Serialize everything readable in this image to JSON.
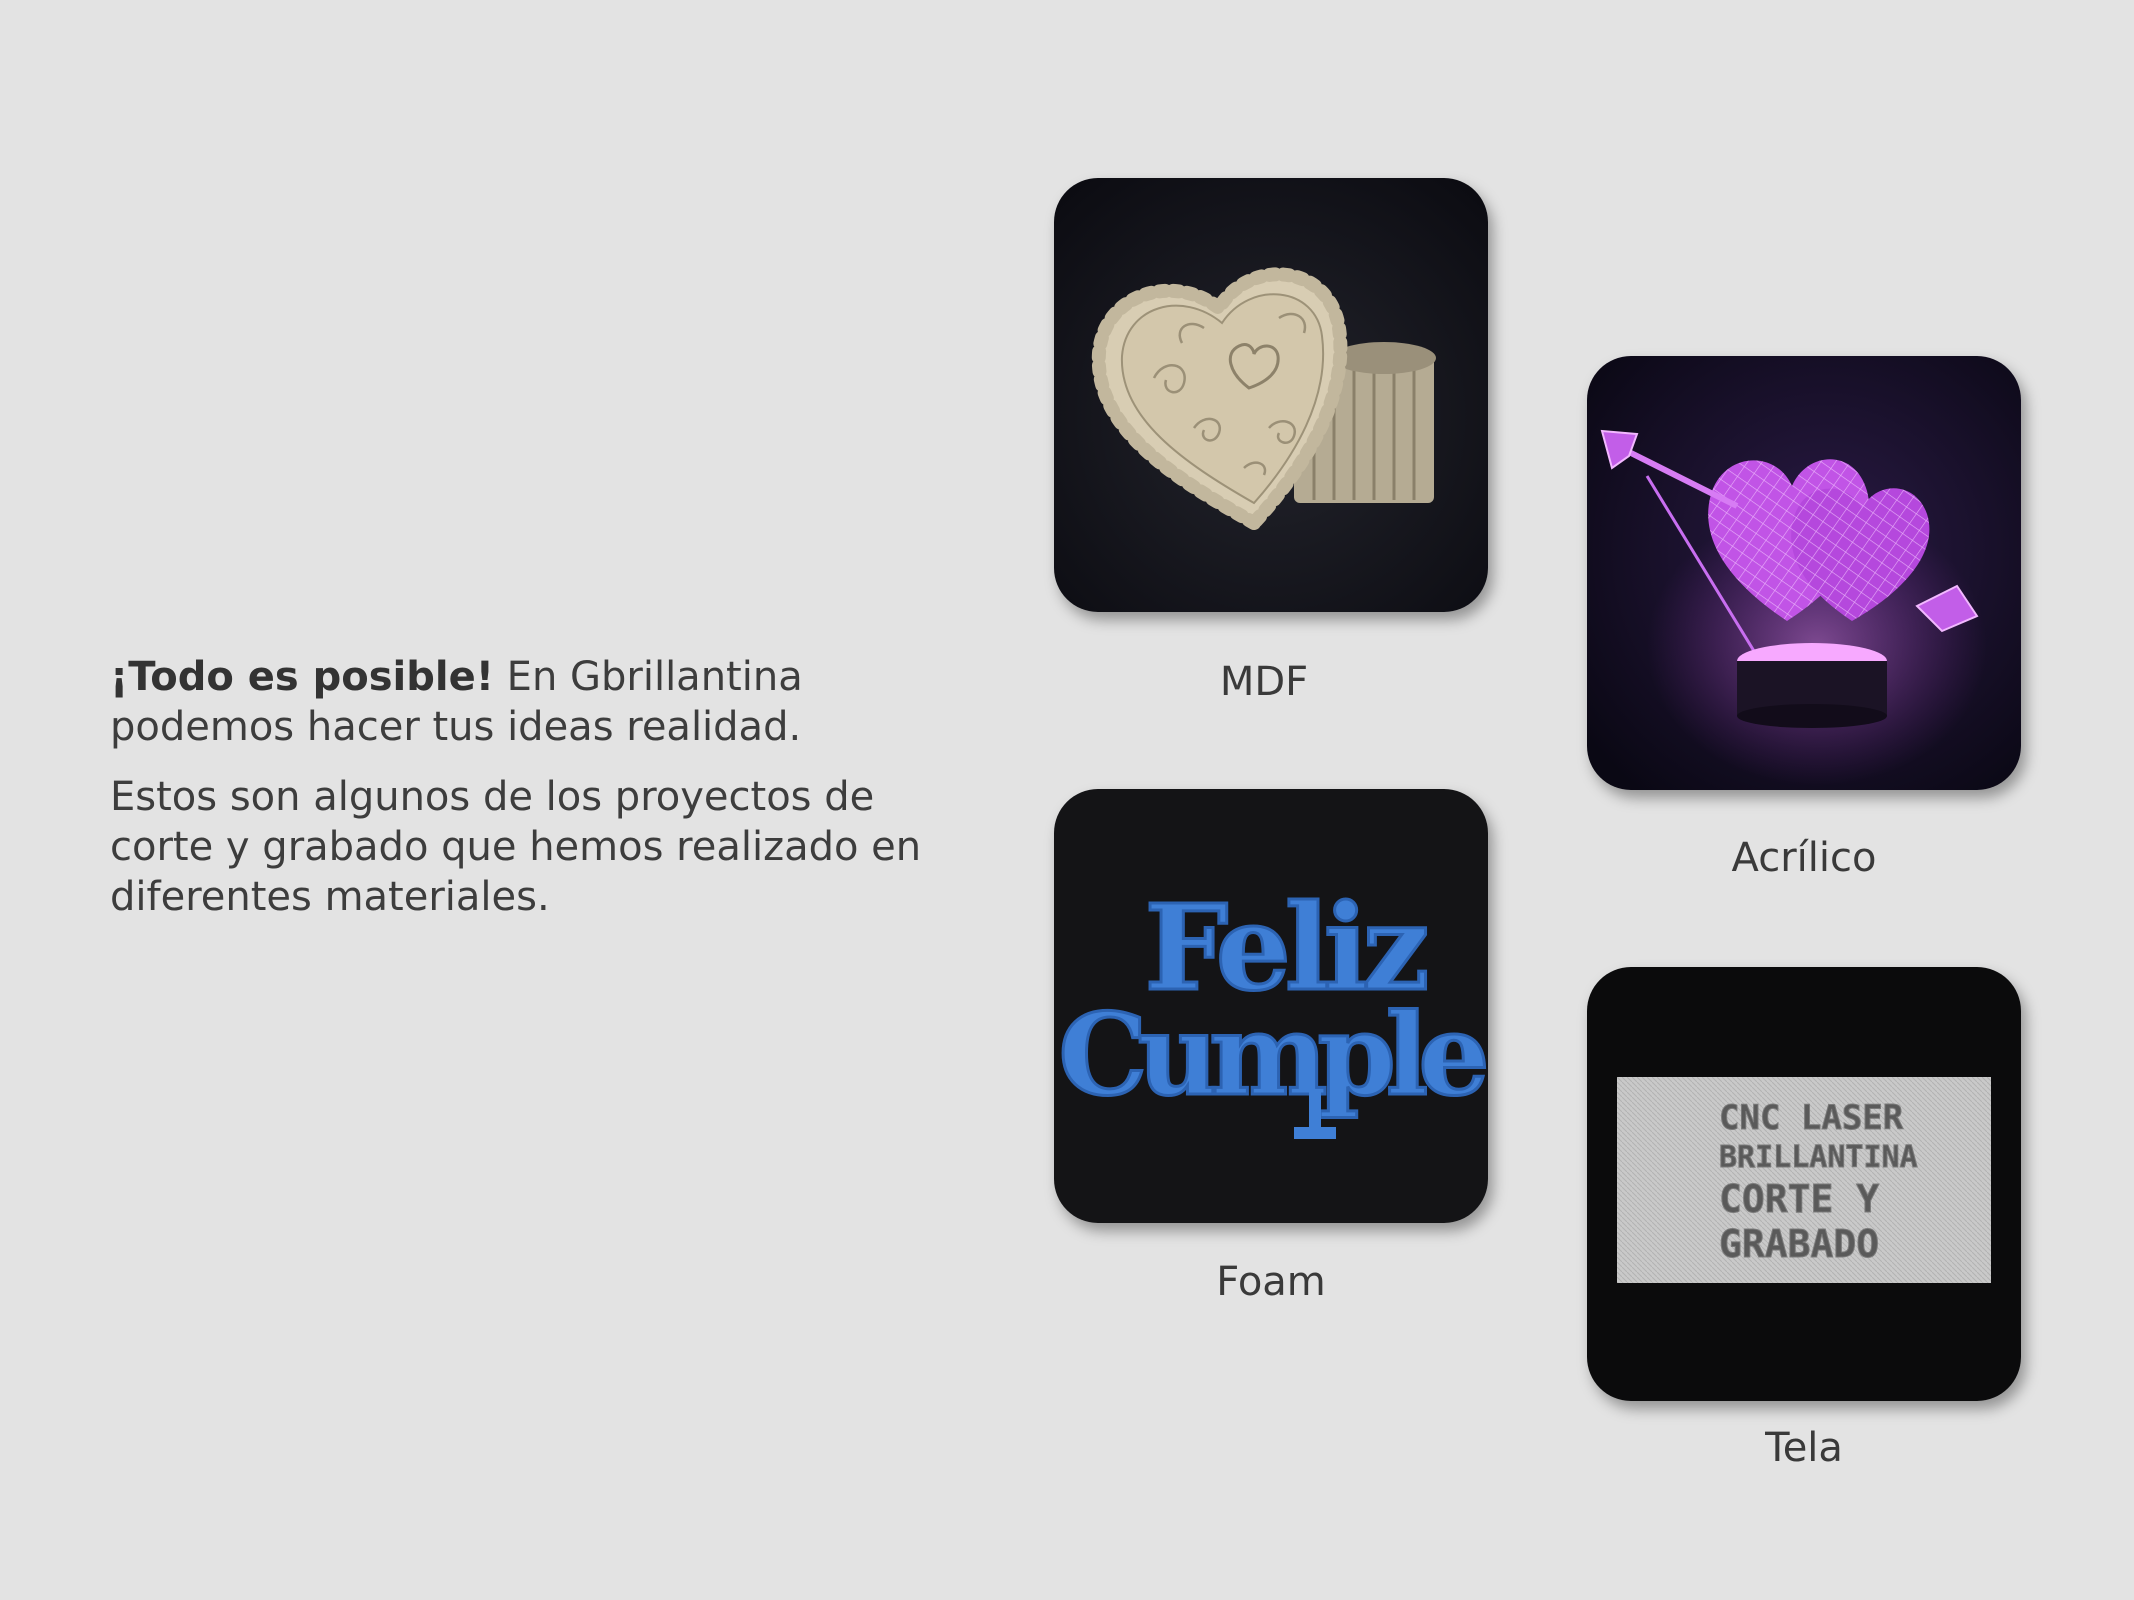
{
  "intro": {
    "bold": "¡Todo es posible!",
    "line1_rest": " En Gbrillantina",
    "line1_cont": "podemos hacer tus ideas realidad.",
    "paragraph2": "Estos son algunos de los proyectos de corte y grabado que hemos realizado en diferentes materiales."
  },
  "materials": {
    "mdf": {
      "label": "MDF",
      "icon": "heart-box-image"
    },
    "acrilico": {
      "label": "Acrílico",
      "icon": "hearts-lamp-image"
    },
    "foam": {
      "label": "Foam",
      "icon": "feliz-cumple-image",
      "photo_text_1": "Feliz",
      "photo_text_2": "Cumple"
    },
    "tela": {
      "label": "Tela",
      "icon": "engraved-fabric-image",
      "photo_lines": [
        "CNC LASER",
        "BRILLANTINA",
        "CORTE Y",
        "GRABADO"
      ]
    }
  },
  "colors": {
    "background": "#e3e3e3",
    "foam_blue": "#3f7fd6",
    "acrylic_magenta": "#d05cf0"
  }
}
